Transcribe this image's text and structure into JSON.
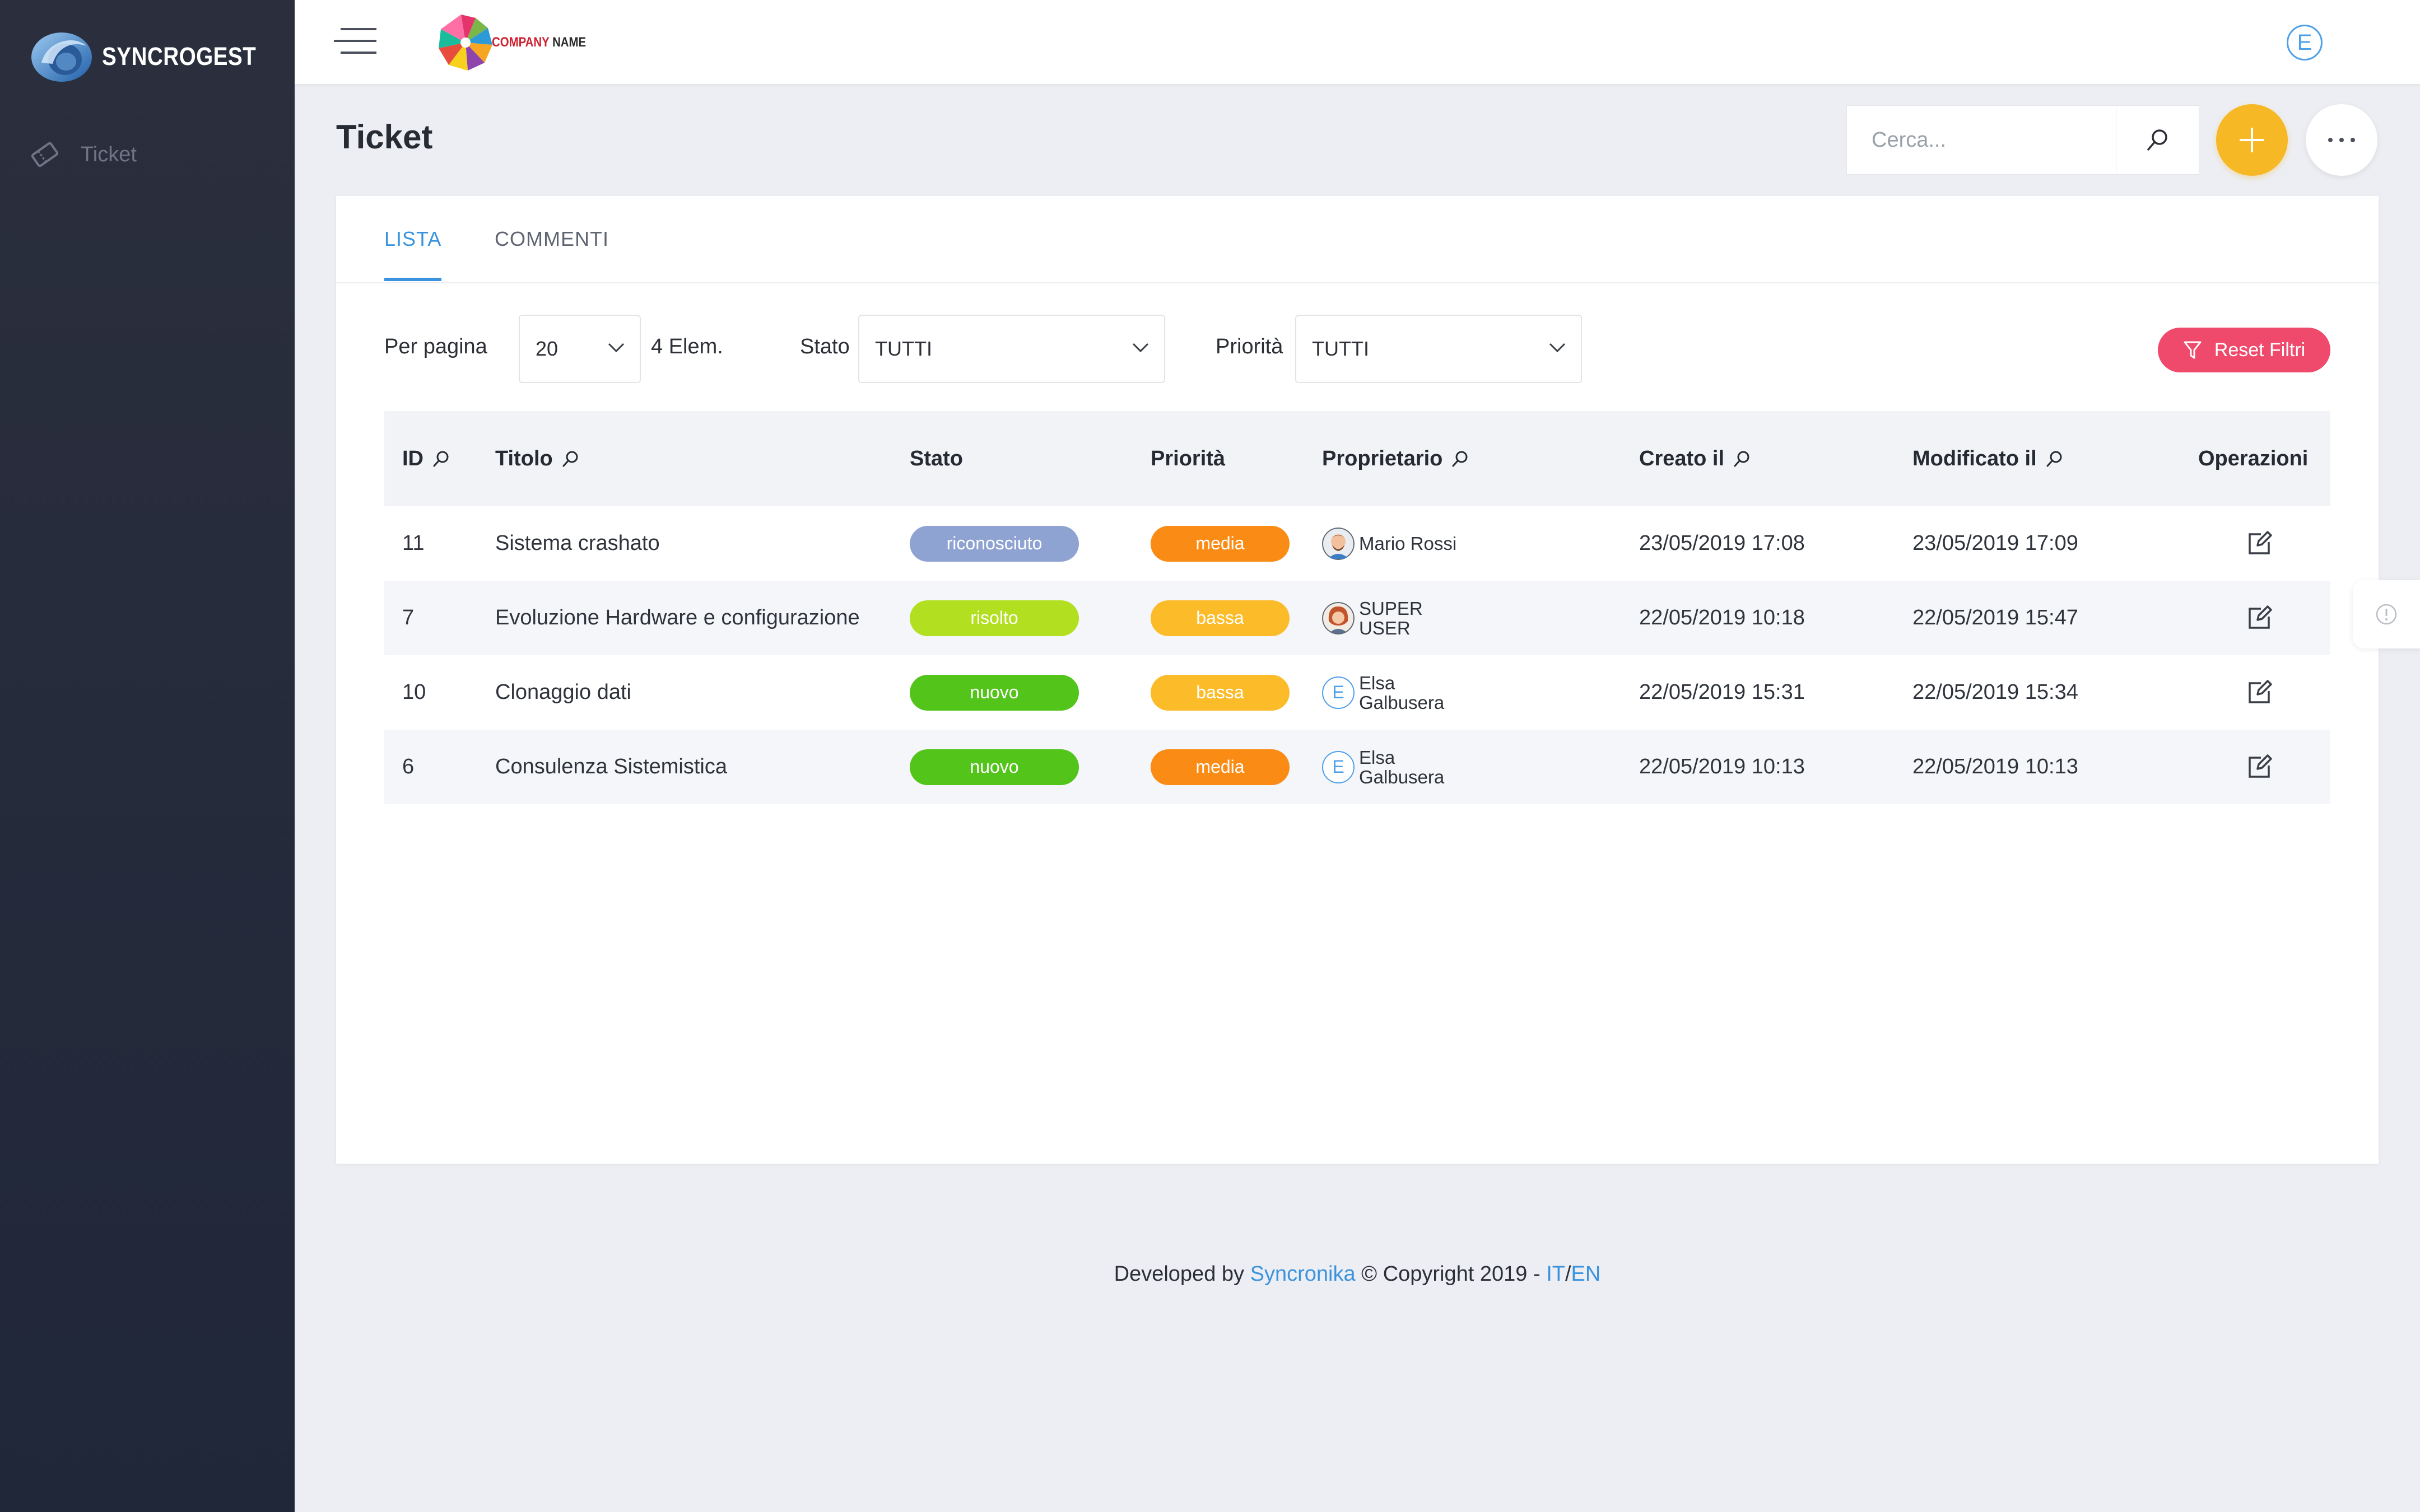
{
  "sidebar": {
    "brand_name": "SYNCROGEST",
    "items": [
      {
        "label": "Ticket",
        "icon": "ticket-icon"
      }
    ]
  },
  "topbar": {
    "company_logo_text": "COMPANY",
    "company_logo_text2": "NAME",
    "user_initial": "E"
  },
  "page": {
    "title": "Ticket",
    "search_placeholder": "Cerca..."
  },
  "tabs": [
    {
      "label": "LISTA",
      "active": true
    },
    {
      "label": "COMMENTI",
      "active": false
    }
  ],
  "filters": {
    "per_page_label": "Per pagina",
    "per_page_value": "20",
    "count_text": "4 Elem.",
    "stato_label": "Stato",
    "stato_value": "TUTTI",
    "priorita_label": "Priorità",
    "priorita_value": "TUTTI",
    "reset_label": "Reset Filtri"
  },
  "table": {
    "columns": {
      "id": "ID",
      "titolo": "Titolo",
      "stato": "Stato",
      "priorita": "Priorità",
      "proprietario": "Proprietario",
      "creato": "Creato il",
      "modificato": "Modificato il",
      "operazioni": "Operazioni"
    },
    "rows": [
      {
        "id": "11",
        "titolo": "Sistema crashato",
        "stato": "riconosciuto",
        "priorita": "media",
        "owner_line1": "Mario Rossi",
        "owner_line2": "",
        "creato": "23/05/2019 17:08",
        "modificato": "23/05/2019 17:09"
      },
      {
        "id": "7",
        "titolo": "Evoluzione Hardware e configurazione",
        "stato": "risolto",
        "priorita": "bassa",
        "owner_line1": "SUPER",
        "owner_line2": "USER",
        "creato": "22/05/2019 10:18",
        "modificato": "22/05/2019 15:47"
      },
      {
        "id": "10",
        "titolo": "Clonaggio dati",
        "stato": "nuovo",
        "priorita": "bassa",
        "owner_initial": "E",
        "owner_line1": "Elsa",
        "owner_line2": "Galbusera",
        "creato": "22/05/2019 15:31",
        "modificato": "22/05/2019 15:34"
      },
      {
        "id": "6",
        "titolo": "Consulenza Sistemistica",
        "stato": "nuovo",
        "priorita": "media",
        "owner_initial": "E",
        "owner_line1": "Elsa",
        "owner_line2": "Galbusera",
        "creato": "22/05/2019 10:13",
        "modificato": "22/05/2019 10:13"
      }
    ]
  },
  "colors": {
    "accent": "#3b93dd",
    "add_button": "#f7b825",
    "reset_button": "#ef4a6b",
    "stato_riconosciuto": "#8fa3d3",
    "stato_risolto": "#b2e021",
    "stato_nuovo": "#52c41a",
    "priorita_media": "#fa8c16",
    "priorita_bassa": "#fcbc2a"
  },
  "footer": {
    "prefix": "Developed by",
    "company": "Syncronika",
    "copyright": "© Copyright 2019 -",
    "lang_it": "IT",
    "separator": "/",
    "lang_en": "EN"
  }
}
